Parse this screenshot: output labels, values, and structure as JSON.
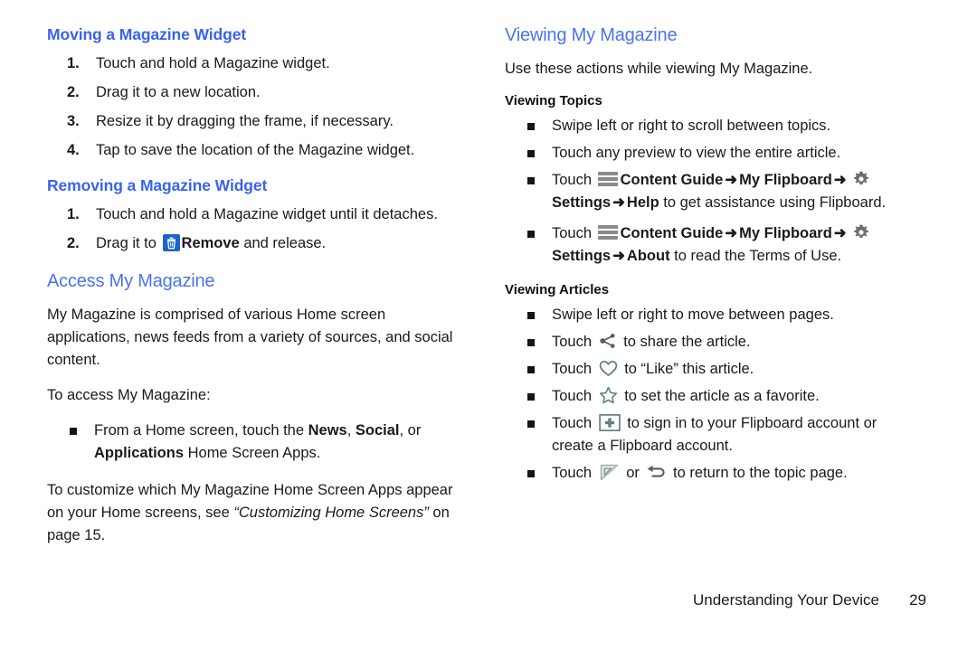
{
  "document": {
    "footer_title": "Understanding Your Device",
    "page_number": "29"
  },
  "colors": {
    "heading_bold_blue": "#3a63ee",
    "heading_light_blue": "#4a74ee",
    "trash_icon_blue": "#1f63c8",
    "menu_icon_gray": "#8a8a8a",
    "gear_icon_gray": "#6e6e6e",
    "teal_icon": "#60807f",
    "body_text": "#1a1a1a"
  },
  "left_column": {
    "section_moving": {
      "heading": "Moving a Magazine Widget",
      "steps": [
        {
          "n": "1.",
          "text": "Touch and hold a Magazine widget."
        },
        {
          "n": "2.",
          "text": "Drag it to a new location."
        },
        {
          "n": "3.",
          "text": "Resize it by dragging the frame, if necessary."
        },
        {
          "n": "4.",
          "text": "Tap to save the location of the Magazine widget."
        }
      ]
    },
    "section_removing": {
      "heading": "Removing a Magazine Widget",
      "step1_n": "1.",
      "step1_text": "Touch and hold a Magazine widget until it detaches.",
      "step2_n": "2.",
      "step2_prefix": "Drag it to ",
      "step2_icon": "trash-icon",
      "step2_bold": "Remove",
      "step2_suffix": " and release."
    },
    "section_access": {
      "heading": "Access My Magazine",
      "para1": "My Magazine is comprised of various Home screen applications, news feeds from a variety of sources, and social content.",
      "para2": "To access My Magazine:",
      "bullet": {
        "prefix": "From a Home screen, touch the ",
        "bold1": "News",
        "sep1": ", ",
        "bold2": "Social",
        "sep2": ", or ",
        "bold3": "Applications",
        "suffix": " Home Screen Apps."
      },
      "para3_a": "To customize which My Magazine Home Screen Apps appear on your Home screens, see ",
      "para3_italic": "“Customizing Home Screens”",
      "para3_b": " on page 15."
    }
  },
  "right_column": {
    "heading": "Viewing My Magazine",
    "intro": "Use these actions while viewing My Magazine.",
    "section_topics": {
      "subheading": "Viewing Topics",
      "bullet1": "Swipe left or right to scroll between topics.",
      "bullet2": "Touch any preview to view the entire article.",
      "bullet3": {
        "touch": "Touch ",
        "icon_menu": "hamburger-menu-icon",
        "b1": "Content Guide",
        "arrow1": "➜",
        "b2": "My Flipboard",
        "arrow2": "➜",
        "icon_gear": "gear-icon",
        "b3": "Settings",
        "arrow3": "➜",
        "b4": "Help",
        "tail": " to get assistance using Flipboard."
      },
      "bullet4": {
        "touch": "Touch ",
        "icon_menu": "hamburger-menu-icon",
        "b1": "Content Guide",
        "arrow1": "➜",
        "b2": "My Flipboard",
        "arrow2": "➜",
        "icon_gear": "gear-icon",
        "b3": "Settings",
        "arrow3": "➜",
        "b4": "About",
        "tail": " to read the Terms of Use."
      }
    },
    "section_articles": {
      "subheading": "Viewing Articles",
      "bullet1": "Swipe left or right to move between pages.",
      "bullet2": {
        "pre": "Touch ",
        "icon": "share-icon",
        "post": " to share the article."
      },
      "bullet3": {
        "pre": "Touch ",
        "icon": "heart-icon",
        "post": " to “Like” this article."
      },
      "bullet4": {
        "pre": "Touch ",
        "icon": "star-icon",
        "post": " to set the article as a favorite."
      },
      "bullet5": {
        "pre": "Touch ",
        "icon": "plus-box-icon",
        "post": " to sign in to your Flipboard account or create a Flipboard account."
      },
      "bullet6": {
        "pre": "Touch ",
        "icon1": "page-flip-icon",
        "mid": " or ",
        "icon2": "back-arrow-icon",
        "post": " to return to the topic page."
      }
    }
  }
}
